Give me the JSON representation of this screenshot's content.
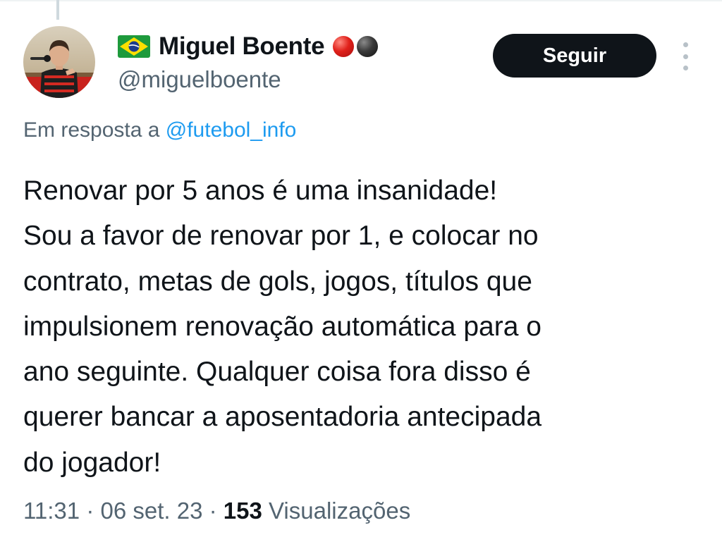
{
  "user": {
    "display_name": "Miguel Boente",
    "handle": "@miguelboente",
    "flag_icon": "brazil-flag-icon",
    "badge_icons": [
      "red-circle-icon",
      "black-circle-icon"
    ]
  },
  "actions": {
    "follow_label": "Seguir",
    "more_icon": "vertical-ellipsis-icon"
  },
  "reply": {
    "prefix": "Em resposta a",
    "mention": "@futebol_info"
  },
  "tweet": {
    "lines": [
      "Renovar por 5 anos é uma insanidade!",
      "Sou a favor de renovar por 1, e colocar no",
      "contrato, metas de gols, jogos, títulos que",
      "impulsionem renovação automática para o",
      "ano seguinte. Qualquer coisa fora disso é",
      "querer bancar a aposentadoria antecipada",
      "do jogador!"
    ]
  },
  "meta": {
    "time": "11:31",
    "separator": "·",
    "date": "06 set. 23",
    "views_count": "153",
    "views_label": "Visualizações"
  },
  "colors": {
    "text_primary": "#0f1419",
    "text_secondary": "#536471",
    "link": "#1d9bf0",
    "button_bg": "#0f1419"
  }
}
